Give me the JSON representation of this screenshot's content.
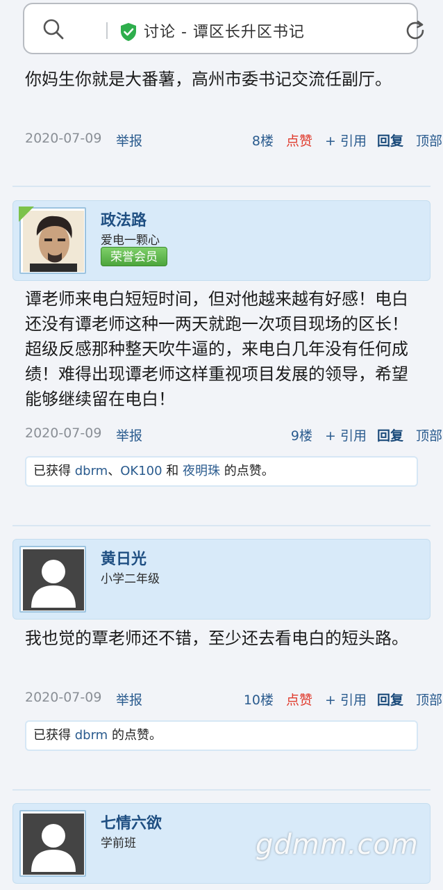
{
  "browser": {
    "page_title": "讨论 - 谭区长升区书记",
    "search_icon": "search-icon",
    "secure_icon": "shield-check-icon",
    "refresh_icon": "refresh-icon"
  },
  "posts": [
    {
      "text": "你妈生你就是大番薯，高州市委书记交流任副厅。",
      "date": "2020-07-09",
      "report": "举报",
      "floor": "8楼",
      "like": "点赞",
      "quote": "+ 引用",
      "reply": "回复",
      "top": "顶部"
    },
    {
      "user": {
        "name": "政法路",
        "level": "爱电一颗心",
        "badge": "荣誉会员"
      },
      "text": "谭老师来电白短短时间，但对他越来越有好感！电白还没有谭老师这种一两天就跑一次项目现场的区长！超级反感那种整天吹牛逼的，来电白几年没有任何成绩！难得出现谭老师这样重视项目发展的领导，希望能够继续留在电白！",
      "date": "2020-07-09",
      "report": "举报",
      "floor": "9楼",
      "quote": "+ 引用",
      "reply": "回复",
      "top": "顶部",
      "likes": {
        "prefix": "已获得",
        "user1": "dbrm",
        "sep1": "、",
        "user2": "OK100",
        "sep2": " 和 ",
        "user3": "夜明珠",
        "suffix": " 的点赞。"
      }
    },
    {
      "user": {
        "name": "黄日光",
        "level": "小学二年级"
      },
      "text": "我也觉的覃老师还不错，至少还去看电白的短头路。",
      "date": "2020-07-09",
      "report": "举报",
      "floor": "10楼",
      "like": "点赞",
      "quote": "+ 引用",
      "reply": "回复",
      "top": "顶部",
      "likes": {
        "prefix": "已获得 ",
        "user1": "dbrm",
        "suffix": " 的点赞。"
      }
    },
    {
      "user": {
        "name": "七情六欲",
        "level": "学前班"
      }
    }
  ],
  "watermark": "gdmm.com"
}
